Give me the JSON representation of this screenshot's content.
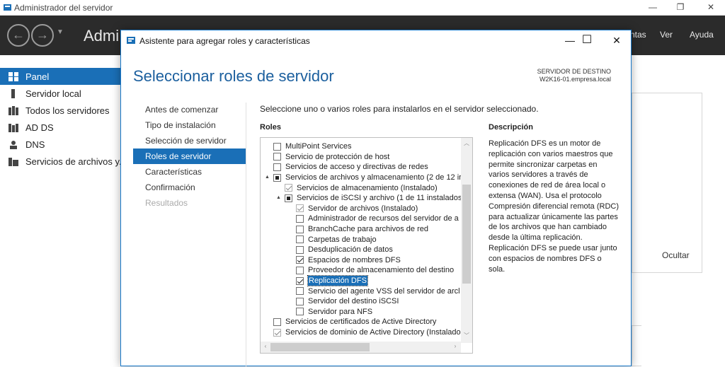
{
  "outer_window": {
    "title": "Administrador del servidor",
    "min": "—",
    "restore": "❐",
    "close": "✕"
  },
  "header": {
    "title": "Admi",
    "menu": [
      "ntas",
      "Ver",
      "Ayuda"
    ]
  },
  "sidebar": {
    "items": [
      {
        "label": "Panel",
        "icon": "dashboard-icon",
        "selected": true
      },
      {
        "label": "Servidor local",
        "icon": "server-icon",
        "selected": false
      },
      {
        "label": "Todos los servidores",
        "icon": "servers-icon",
        "selected": false
      },
      {
        "label": "AD DS",
        "icon": "ad-ds-icon",
        "selected": false
      },
      {
        "label": "DNS",
        "icon": "dns-icon",
        "selected": false
      },
      {
        "label": "Servicios de archivos y...",
        "icon": "file-services-icon",
        "selected": false
      }
    ]
  },
  "background_panel": {
    "ocultar": "Ocultar"
  },
  "dialog": {
    "title": "Asistente para agregar roles y características",
    "min": "—",
    "max": "☐",
    "close": "✕",
    "heading": "Seleccionar roles de servidor",
    "dest_label": "SERVIDOR DE DESTINO",
    "dest_server": "W2K16-01.empresa.local",
    "nav": [
      {
        "label": "Antes de comenzar",
        "state": "normal"
      },
      {
        "label": "Tipo de instalación",
        "state": "normal"
      },
      {
        "label": "Selección de servidor",
        "state": "normal"
      },
      {
        "label": "Roles de servidor",
        "state": "selected"
      },
      {
        "label": "Características",
        "state": "normal"
      },
      {
        "label": "Confirmación",
        "state": "normal"
      },
      {
        "label": "Resultados",
        "state": "disabled"
      }
    ],
    "instruction": "Seleccione uno o varios roles para instalarlos en el servidor seleccionado.",
    "roles_label": "Roles",
    "description_label": "Descripción",
    "description": "Replicación DFS es un motor de replicación con varios maestros que permite sincronizar carpetas en varios servidores a través de conexiones de red de área local o extensa (WAN). Usa el protocolo Compresión diferencial remota (RDC) para actualizar únicamente las partes de los archivos que han cambiado desde la última replicación. Replicación DFS se puede usar junto con espacios de nombres DFS o sola.",
    "roles": [
      {
        "label": "MultiPoint Services",
        "level": 0,
        "state": "unchecked",
        "expander": ""
      },
      {
        "label": "Servicio de protección de host",
        "level": 0,
        "state": "unchecked",
        "expander": ""
      },
      {
        "label": "Servicios de acceso y directivas de redes",
        "level": 0,
        "state": "unchecked",
        "expander": ""
      },
      {
        "label": "Servicios de archivos y almacenamiento (2 de 12 ir",
        "level": 0,
        "state": "partial",
        "expander": "▲"
      },
      {
        "label": "Servicios de almacenamiento (Instalado)",
        "level": 1,
        "state": "checked-disabled",
        "expander": ""
      },
      {
        "label": "Servicios de iSCSI y archivo (1 de 11 instalados",
        "level": 1,
        "state": "partial",
        "expander": "▲"
      },
      {
        "label": "Servidor de archivos (Instalado)",
        "level": 2,
        "state": "checked-disabled",
        "expander": ""
      },
      {
        "label": "Administrador de recursos del servidor de a",
        "level": 2,
        "state": "unchecked",
        "expander": ""
      },
      {
        "label": "BranchCache para archivos de red",
        "level": 2,
        "state": "unchecked",
        "expander": ""
      },
      {
        "label": "Carpetas de trabajo",
        "level": 2,
        "state": "unchecked",
        "expander": ""
      },
      {
        "label": "Desduplicación de datos",
        "level": 2,
        "state": "unchecked",
        "expander": ""
      },
      {
        "label": "Espacios de nombres DFS",
        "level": 2,
        "state": "checked",
        "expander": ""
      },
      {
        "label": "Proveedor de almacenamiento del destino",
        "level": 2,
        "state": "unchecked",
        "expander": ""
      },
      {
        "label": "Replicación DFS",
        "level": 2,
        "state": "checked",
        "expander": "",
        "highlighted": true
      },
      {
        "label": "Servicio del agente VSS del servidor de arcl",
        "level": 2,
        "state": "unchecked",
        "expander": ""
      },
      {
        "label": "Servidor del destino iSCSI",
        "level": 2,
        "state": "unchecked",
        "expander": ""
      },
      {
        "label": "Servidor para NFS",
        "level": 2,
        "state": "unchecked",
        "expander": ""
      },
      {
        "label": "Servicios de certificados de Active Directory",
        "level": 0,
        "state": "unchecked",
        "expander": ""
      },
      {
        "label": "Servicios de dominio de Active Directory (Instalado",
        "level": 0,
        "state": "checked-disabled",
        "expander": ""
      }
    ]
  }
}
